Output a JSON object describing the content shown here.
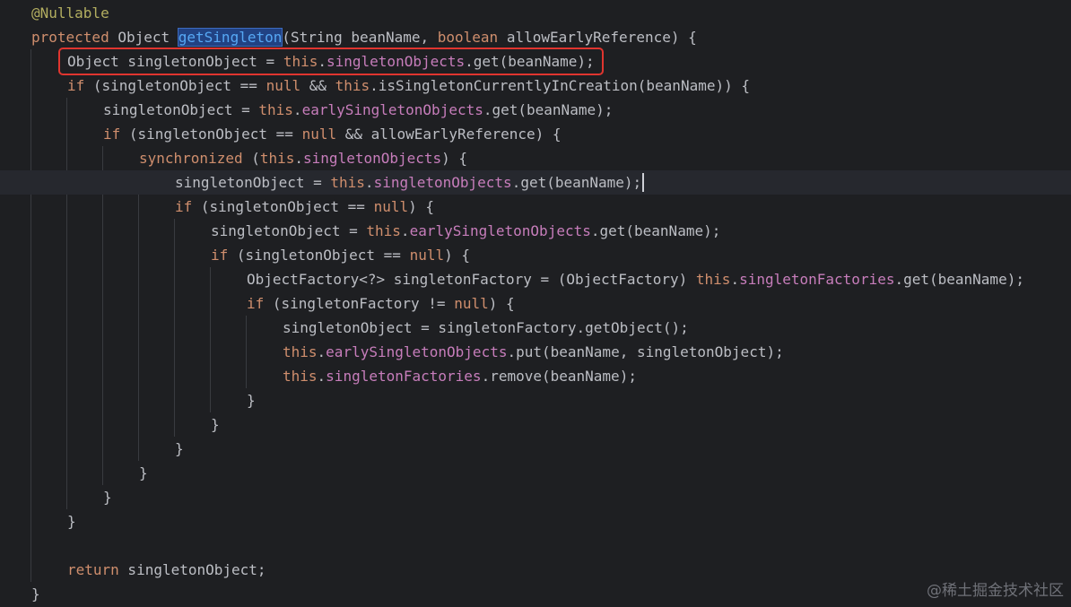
{
  "editor": {
    "colors": {
      "background": "#1e1f22",
      "keyword": "#cf8e6d",
      "annotation": "#b3ae60",
      "field": "#c77dbb",
      "plain": "#bcbec4",
      "method_highlight": "#56a8f5",
      "highlight_box": "#e0352f"
    },
    "current_line_index": 7,
    "boxed_line_index": 2,
    "lines": [
      {
        "indent": 0,
        "tokens": [
          {
            "t": "@Nullable",
            "c": "ann"
          }
        ]
      },
      {
        "indent": 0,
        "tokens": [
          {
            "t": "protected",
            "c": "kw"
          },
          {
            "t": " Object ",
            "c": "plain"
          },
          {
            "t": "getSingleton",
            "c": "hl"
          },
          {
            "t": "(String beanName, ",
            "c": "plain"
          },
          {
            "t": "boolean",
            "c": "kw"
          },
          {
            "t": " allowEarlyReference) {",
            "c": "plain"
          }
        ]
      },
      {
        "indent": 1,
        "tokens": [
          {
            "t": "Object singletonObject = ",
            "c": "plain"
          },
          {
            "t": "this",
            "c": "kw"
          },
          {
            "t": ".",
            "c": "plain"
          },
          {
            "t": "singletonObjects",
            "c": "field"
          },
          {
            "t": ".get(beanName);",
            "c": "plain"
          }
        ]
      },
      {
        "indent": 1,
        "tokens": [
          {
            "t": "if",
            "c": "kw"
          },
          {
            "t": " (singletonObject == ",
            "c": "plain"
          },
          {
            "t": "null",
            "c": "kw"
          },
          {
            "t": " && ",
            "c": "plain"
          },
          {
            "t": "this",
            "c": "kw"
          },
          {
            "t": ".isSingletonCurrentlyInCreation(beanName)) {",
            "c": "plain"
          }
        ]
      },
      {
        "indent": 2,
        "tokens": [
          {
            "t": "singletonObject = ",
            "c": "plain"
          },
          {
            "t": "this",
            "c": "kw"
          },
          {
            "t": ".",
            "c": "plain"
          },
          {
            "t": "earlySingletonObjects",
            "c": "field"
          },
          {
            "t": ".get(beanName);",
            "c": "plain"
          }
        ]
      },
      {
        "indent": 2,
        "tokens": [
          {
            "t": "if",
            "c": "kw"
          },
          {
            "t": " (singletonObject == ",
            "c": "plain"
          },
          {
            "t": "null",
            "c": "kw"
          },
          {
            "t": " && allowEarlyReference) {",
            "c": "plain"
          }
        ]
      },
      {
        "indent": 3,
        "tokens": [
          {
            "t": "synchronized",
            "c": "kw"
          },
          {
            "t": " (",
            "c": "plain"
          },
          {
            "t": "this",
            "c": "kw"
          },
          {
            "t": ".",
            "c": "plain"
          },
          {
            "t": "singletonObjects",
            "c": "field"
          },
          {
            "t": ") {",
            "c": "plain"
          }
        ]
      },
      {
        "indent": 4,
        "tokens": [
          {
            "t": "singletonObject = ",
            "c": "plain"
          },
          {
            "t": "this",
            "c": "kw"
          },
          {
            "t": ".",
            "c": "plain"
          },
          {
            "t": "singletonObjects",
            "c": "field"
          },
          {
            "t": ".get(beanName);",
            "c": "plain"
          }
        ]
      },
      {
        "indent": 4,
        "tokens": [
          {
            "t": "if",
            "c": "kw"
          },
          {
            "t": " (singletonObject == ",
            "c": "plain"
          },
          {
            "t": "null",
            "c": "kw"
          },
          {
            "t": ") {",
            "c": "plain"
          }
        ]
      },
      {
        "indent": 5,
        "tokens": [
          {
            "t": "singletonObject = ",
            "c": "plain"
          },
          {
            "t": "this",
            "c": "kw"
          },
          {
            "t": ".",
            "c": "plain"
          },
          {
            "t": "earlySingletonObjects",
            "c": "field"
          },
          {
            "t": ".get(beanName);",
            "c": "plain"
          }
        ]
      },
      {
        "indent": 5,
        "tokens": [
          {
            "t": "if",
            "c": "kw"
          },
          {
            "t": " (singletonObject == ",
            "c": "plain"
          },
          {
            "t": "null",
            "c": "kw"
          },
          {
            "t": ") {",
            "c": "plain"
          }
        ]
      },
      {
        "indent": 6,
        "tokens": [
          {
            "t": "ObjectFactory<?> singletonFactory = (ObjectFactory) ",
            "c": "plain"
          },
          {
            "t": "this",
            "c": "kw"
          },
          {
            "t": ".",
            "c": "plain"
          },
          {
            "t": "singletonFactories",
            "c": "field"
          },
          {
            "t": ".get(beanName);",
            "c": "plain"
          }
        ]
      },
      {
        "indent": 6,
        "tokens": [
          {
            "t": "if",
            "c": "kw"
          },
          {
            "t": " (singletonFactory != ",
            "c": "plain"
          },
          {
            "t": "null",
            "c": "kw"
          },
          {
            "t": ") {",
            "c": "plain"
          }
        ]
      },
      {
        "indent": 7,
        "tokens": [
          {
            "t": "singletonObject = singletonFactory.getObject();",
            "c": "plain"
          }
        ]
      },
      {
        "indent": 7,
        "tokens": [
          {
            "t": "this",
            "c": "kw"
          },
          {
            "t": ".",
            "c": "plain"
          },
          {
            "t": "earlySingletonObjects",
            "c": "field"
          },
          {
            "t": ".put(beanName, singletonObject);",
            "c": "plain"
          }
        ]
      },
      {
        "indent": 7,
        "tokens": [
          {
            "t": "this",
            "c": "kw"
          },
          {
            "t": ".",
            "c": "plain"
          },
          {
            "t": "singletonFactories",
            "c": "field"
          },
          {
            "t": ".remove(beanName);",
            "c": "plain"
          }
        ]
      },
      {
        "indent": 6,
        "tokens": [
          {
            "t": "}",
            "c": "plain"
          }
        ]
      },
      {
        "indent": 5,
        "tokens": [
          {
            "t": "}",
            "c": "plain"
          }
        ]
      },
      {
        "indent": 4,
        "tokens": [
          {
            "t": "}",
            "c": "plain"
          }
        ]
      },
      {
        "indent": 3,
        "tokens": [
          {
            "t": "}",
            "c": "plain"
          }
        ]
      },
      {
        "indent": 2,
        "tokens": [
          {
            "t": "}",
            "c": "plain"
          }
        ]
      },
      {
        "indent": 1,
        "tokens": [
          {
            "t": "}",
            "c": "plain"
          }
        ]
      },
      {
        "indent": 0,
        "tokens": []
      },
      {
        "indent": 1,
        "tokens": [
          {
            "t": "return",
            "c": "kw"
          },
          {
            "t": " singletonObject;",
            "c": "plain"
          }
        ]
      },
      {
        "indent": 0,
        "tokens": [
          {
            "t": "}",
            "c": "plain"
          }
        ]
      }
    ]
  },
  "watermark": "@稀土掘金技术社区"
}
